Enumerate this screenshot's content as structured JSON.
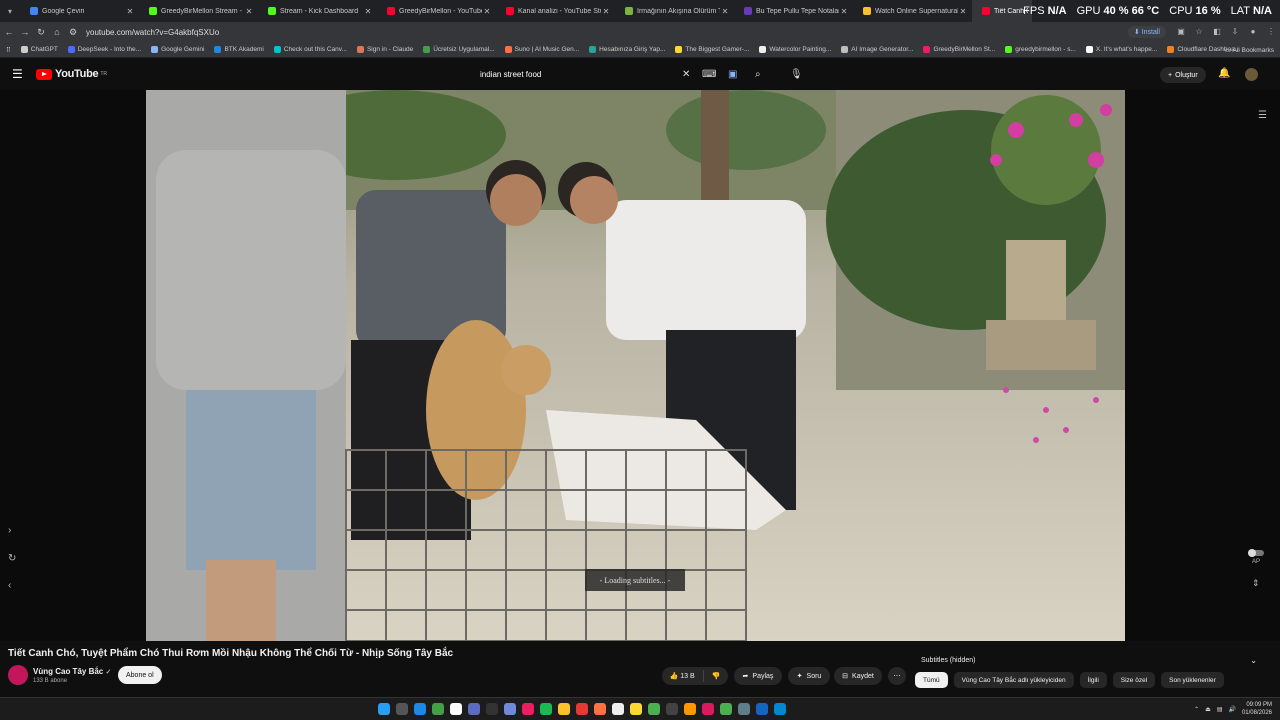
{
  "browser": {
    "tabs": [
      {
        "title": "Google Çeviri",
        "color": "#4285f4",
        "active": false
      },
      {
        "title": "GreedyBirMellon Stream - Watc",
        "color": "#53fc18",
        "active": false
      },
      {
        "title": "Stream - Kick Dashboard",
        "color": "#53fc18",
        "active": false
      },
      {
        "title": "GreedyBirMellon - YouTube",
        "color": "#ff0033",
        "active": false
      },
      {
        "title": "Kanal analizi - YouTube Studio",
        "color": "#ff0033",
        "active": false
      },
      {
        "title": "Irmağının Akışına Ölürüm Türkü",
        "color": "#7cb342",
        "active": false
      },
      {
        "title": "Bu Tepe Pullu Tepe Notaları | Fl",
        "color": "#673ab7",
        "active": false
      },
      {
        "title": "Watch Online Supernatural Sea",
        "color": "#fbc02d",
        "active": false
      },
      {
        "title": "Tiết Canh Chó, Tuyệt",
        "color": "#ff0033",
        "active": true
      }
    ],
    "perf": {
      "fps_label": "FPS",
      "fps_value": "N/A",
      "gpu_label": "GPU",
      "gpu_value": "40 % 66 °C",
      "cpu_label": "CPU",
      "cpu_value": "16 %",
      "lat_label": "LAT",
      "lat_value": "N/A"
    },
    "url": "youtube.com/watch?v=G4akbfqSXUo",
    "install_label": "Install",
    "bookmarks": [
      {
        "label": "ChatGPT",
        "color": "#ccc"
      },
      {
        "label": "DeepSeek - Into the...",
        "color": "#4d6bfe"
      },
      {
        "label": "Google Gemini",
        "color": "#8ab4f8"
      },
      {
        "label": "BTK Akademi",
        "color": "#1e88e5"
      },
      {
        "label": "Check out this Canv...",
        "color": "#00c4cc"
      },
      {
        "label": "Sign in - Claude",
        "color": "#d97757"
      },
      {
        "label": "Ücretsiz Uygulamal...",
        "color": "#43a047"
      },
      {
        "label": "Suno | AI Music Gen...",
        "color": "#ff7043"
      },
      {
        "label": "Hesabınıza Giriş Yap...",
        "color": "#26a69a"
      },
      {
        "label": "The Biggest Gamer-...",
        "color": "#fdd835"
      },
      {
        "label": "Watercolor Painting...",
        "color": "#eeeeee"
      },
      {
        "label": "AI Image Generator...",
        "color": "#bdbdbd"
      },
      {
        "label": "GreedyBirMellon St...",
        "color": "#e91e63"
      },
      {
        "label": "greedybirmellon - s...",
        "color": "#53fc18"
      },
      {
        "label": "X. It's what's happe...",
        "color": "#ffffff"
      },
      {
        "label": "Cloudflare Dashboa...",
        "color": "#f48120"
      }
    ],
    "all_bookmarks_label": "All Bookmarks"
  },
  "youtube": {
    "logo_text": "YouTube",
    "region": "TR",
    "search_value": "indian street food",
    "create_label": "Oluştur",
    "subtitle_overlay": "- Loading subtitles... -",
    "ap_label": "AP",
    "video_title": "Tiết Canh Chó, Tuyệt Phẩm Chó Thui Rơm Mồi Nhậu Không Thể Chối Từ - Nhịp Sống Tây Bắc",
    "channel_name": "Vùng Cao Tây Bắc",
    "subscribers": "133 B abone",
    "subscribe_label": "Abone ol",
    "likes": "13 B",
    "share_label": "Paylaş",
    "ask_label": "Soru",
    "save_label": "Kaydet",
    "subtitles_panel": "Subtitles (hidden)",
    "chips": [
      "Tümü",
      "Vùng Cao Tây Bắc adlı yükleyiciden",
      "İlgili",
      "Size özel",
      "Son yüklenenler"
    ]
  },
  "taskbar": {
    "time": "09:09 PM",
    "date": "01/08/2026"
  }
}
